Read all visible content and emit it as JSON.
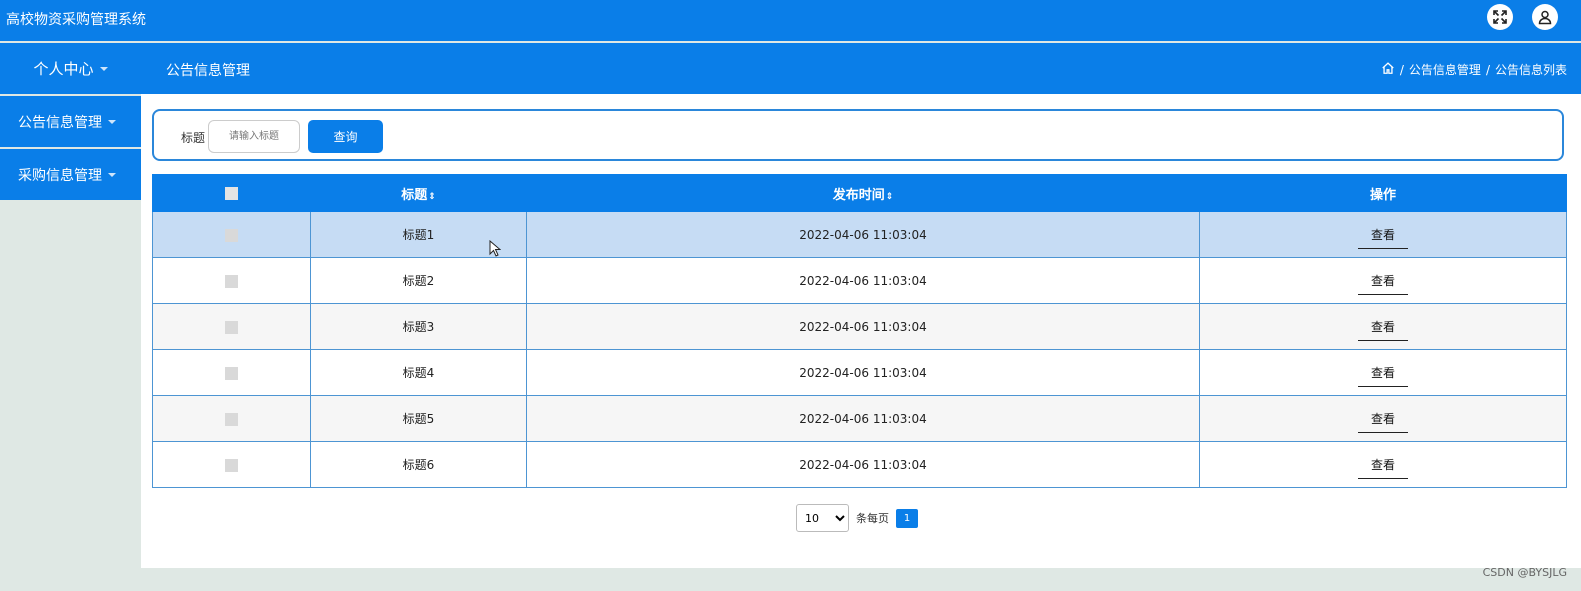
{
  "header": {
    "app_title": "高校物资采购管理系统",
    "fullscreen_icon": "expand-icon",
    "user_icon": "user-icon"
  },
  "nav": {
    "personal_center": "个人中心",
    "page_title": "公告信息管理",
    "breadcrumb": {
      "home_icon": "home-icon",
      "sep1": "/",
      "level1": "公告信息管理",
      "sep2": "/",
      "level2": "公告信息列表"
    }
  },
  "sidebar": {
    "items": [
      {
        "label": "公告信息管理"
      },
      {
        "label": "采购信息管理"
      }
    ]
  },
  "search": {
    "label": "标题",
    "placeholder": "请输入标题",
    "button": "查询"
  },
  "table": {
    "columns": {
      "title": "标题",
      "time": "发布时间",
      "action": "操作"
    },
    "sort_icon": "⇕",
    "rows": [
      {
        "title": "标题1",
        "time": "2022-04-06 11:03:04",
        "action": "查看"
      },
      {
        "title": "标题2",
        "time": "2022-04-06 11:03:04",
        "action": "查看"
      },
      {
        "title": "标题3",
        "time": "2022-04-06 11:03:04",
        "action": "查看"
      },
      {
        "title": "标题4",
        "time": "2022-04-06 11:03:04",
        "action": "查看"
      },
      {
        "title": "标题5",
        "time": "2022-04-06 11:03:04",
        "action": "查看"
      },
      {
        "title": "标题6",
        "time": "2022-04-06 11:03:04",
        "action": "查看"
      }
    ]
  },
  "pagination": {
    "page_size": "10",
    "page_size_options": [
      "10"
    ],
    "per_page_label": "条每页",
    "current_page": "1"
  },
  "watermark": "CSDN @BYSJLG",
  "colors": {
    "primary": "#0a7ee8",
    "selected_row": "#c6dcf4",
    "page_bg": "#dfe8e4"
  }
}
